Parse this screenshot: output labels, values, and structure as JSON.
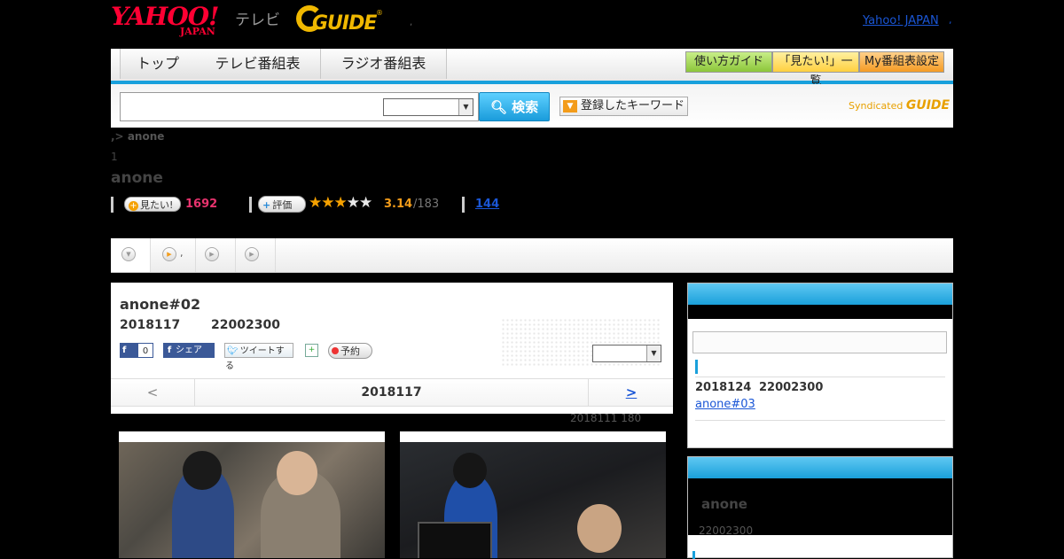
{
  "header": {
    "yahoo_logo": "YAHOO!",
    "yahoo_logo_sub": "JAPAN",
    "tv_label": "テレビ",
    "gguide_logo": "GUIDE",
    "gguide_reg": "®",
    "separator": ",",
    "yahoo_japan_link": "Yahoo! JAPAN",
    "link_suffix": ","
  },
  "nav": {
    "tabs": [
      "トップ",
      "テレビ番組表",
      "ラジオ番組表"
    ],
    "buttons": [
      "使い方ガイド",
      "「見たい!」一覧",
      "My番組表設定"
    ],
    "button_colors": [
      "#9bd24a",
      "#ffd85a",
      "#f7a73a"
    ]
  },
  "search": {
    "input_value": "",
    "select_value": "",
    "button_label": "検索",
    "keyword_button": "登録したキーワード",
    "syndicated_label": "Syndicated",
    "syndicated_brand": "GUIDE"
  },
  "breadcrumb": {
    "separator": ",>",
    "current": "anone"
  },
  "program": {
    "count": "1",
    "title": "anone",
    "mitai_label": "見たい!",
    "mitai_count": "1692",
    "hyouka_label": "評価",
    "stars_filled": 3,
    "stars_total": 5,
    "rating": "3.14",
    "rating_total": "/183",
    "review_count": "144"
  },
  "subtabs": {
    "tab2_suffix": ","
  },
  "episode": {
    "title": "anone#02",
    "date": "2018117",
    "time": "22002300",
    "fb_like_label": "0",
    "fb_share_label": "シェア",
    "tweet_label": "ツイートする",
    "yoyaku_label": "予約",
    "select_value": "",
    "nav_prev": "<",
    "nav_date": "2018117",
    "nav_next": ">",
    "meta": "2018111  180"
  },
  "sidebar": {
    "next_airing": {
      "date": "2018124",
      "time": "22002300",
      "title": "anone#03"
    },
    "program_box": {
      "title": "anone",
      "time": "22002300"
    }
  },
  "colors": {
    "accent_blue": "#18a0dc",
    "link": "#1a56d6",
    "mitai_pink": "#e8336e",
    "rating_orange": "#f39c1a"
  }
}
